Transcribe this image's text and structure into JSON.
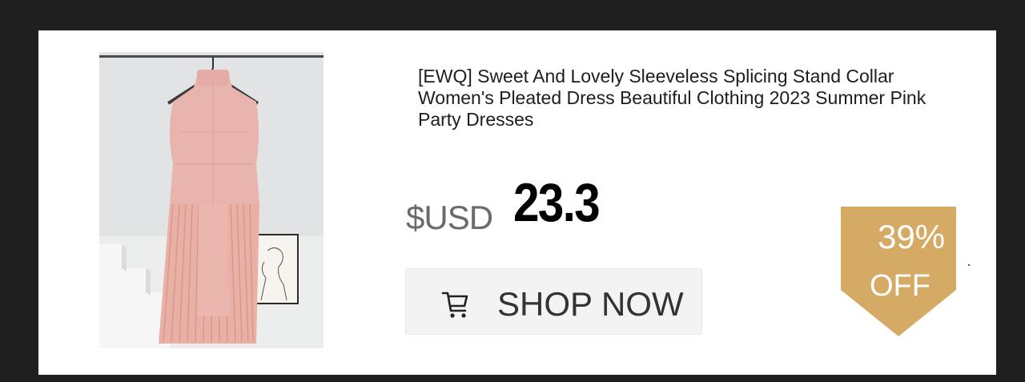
{
  "product": {
    "title": "[EWQ] Sweet And Lovely Sleeveless Splicing Stand Collar Women's Pleated Dress Beautiful Clothing 2023 Summer Pink Party Dresses",
    "currency": "$USD",
    "price": "23.3",
    "image_alt": "Pink sleeveless pleated dress on hanger"
  },
  "shop_button": {
    "label": "SHOP NOW",
    "icon": "cart-icon"
  },
  "discount_badge": {
    "percent": "39%",
    "off_label": "OFF",
    "color": "#d4aa64"
  },
  "colors": {
    "background": "#1f1f1f",
    "card": "#ffffff",
    "dress": "#e9b3ab"
  }
}
